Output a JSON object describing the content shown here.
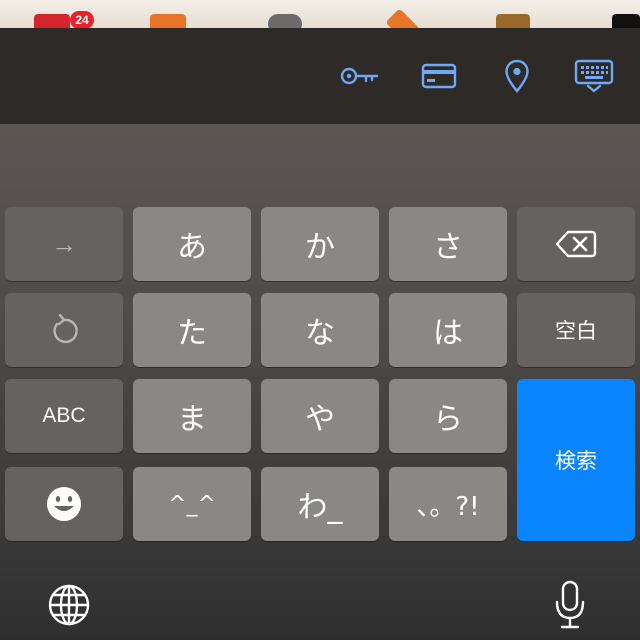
{
  "status_badge": {
    "count": "24"
  },
  "accessory_bar": {
    "buttons": [
      "key-icon",
      "credit-card-icon",
      "location-pin-icon",
      "keyboard-hide-icon"
    ],
    "accent_color": "#6fa8f5"
  },
  "keyboard": {
    "rows": [
      {
        "left": "→",
        "keys": [
          "あ",
          "か",
          "さ"
        ],
        "right_icon": "backspace-icon"
      },
      {
        "left_icon": "undo-icon",
        "keys": [
          "た",
          "な",
          "は"
        ],
        "right": "空白"
      },
      {
        "left": "ABC",
        "keys": [
          "ま",
          "や",
          "ら"
        ],
        "right": "検索"
      },
      {
        "left_icon": "emoji-icon",
        "keys": [
          "^_^",
          "わ_",
          "、。?!"
        ]
      }
    ],
    "bottom": [
      "globe-icon",
      "microphone-icon"
    ],
    "search_color": "#0a84ff"
  }
}
